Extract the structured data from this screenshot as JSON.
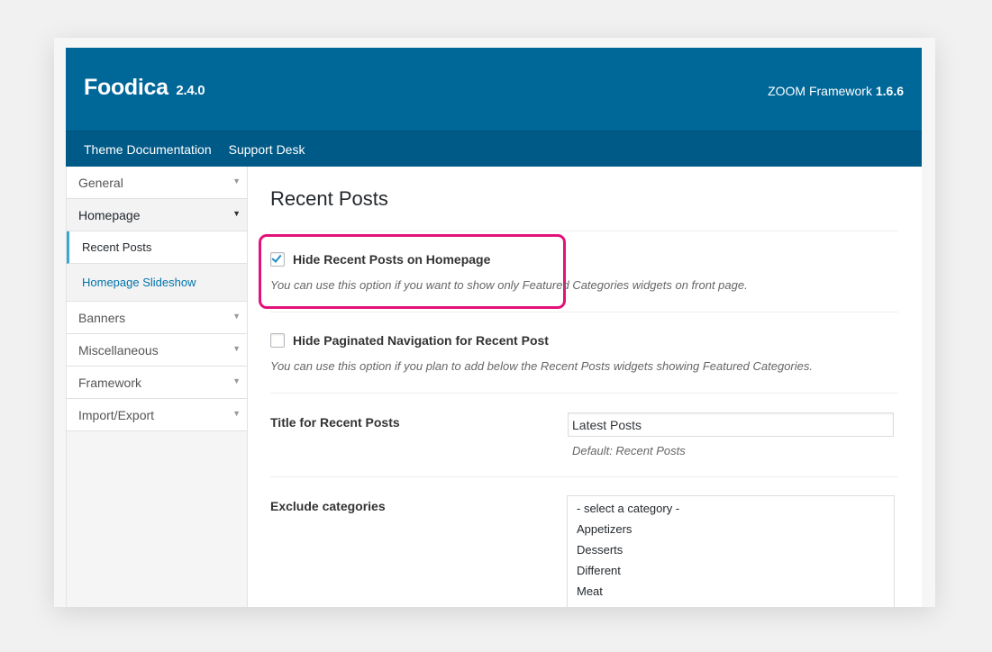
{
  "header": {
    "brand_name": "Foodica",
    "brand_version": "2.4.0",
    "framework_name": "ZOOM Framework",
    "framework_version": "1.6.6"
  },
  "subnav": {
    "links": [
      "Theme Documentation",
      "Support Desk"
    ]
  },
  "sidebar": {
    "items": [
      {
        "label": "General"
      },
      {
        "label": "Homepage"
      },
      {
        "label": "Banners"
      },
      {
        "label": "Miscellaneous"
      },
      {
        "label": "Framework"
      },
      {
        "label": "Import/Export"
      }
    ],
    "homepage_subitems": [
      "Recent Posts",
      "Homepage Slideshow"
    ],
    "active_subitem": "Recent Posts"
  },
  "content": {
    "title": "Recent Posts",
    "options": [
      {
        "label": "Hide Recent Posts on Homepage",
        "checked": true,
        "description": "You can use this option if you want to show only Featured Categories widgets on front page."
      },
      {
        "label": "Hide Paginated Navigation for Recent Post",
        "checked": false,
        "description": "You can use this option if you plan to add below the Recent Posts widgets showing Featured Categories."
      }
    ],
    "title_field": {
      "label": "Title for Recent Posts",
      "value": "Latest Posts",
      "default_note": "Default: Recent Posts"
    },
    "exclude_field": {
      "label": "Exclude categories",
      "options": [
        "- select a category -",
        "Appetizers",
        "Desserts",
        "Different",
        "Meat"
      ]
    }
  },
  "colors": {
    "header_bg": "#006799",
    "subnav_bg": "#005a87",
    "highlight": "#e3127a",
    "checkbox_tick": "#1e8cbe"
  }
}
